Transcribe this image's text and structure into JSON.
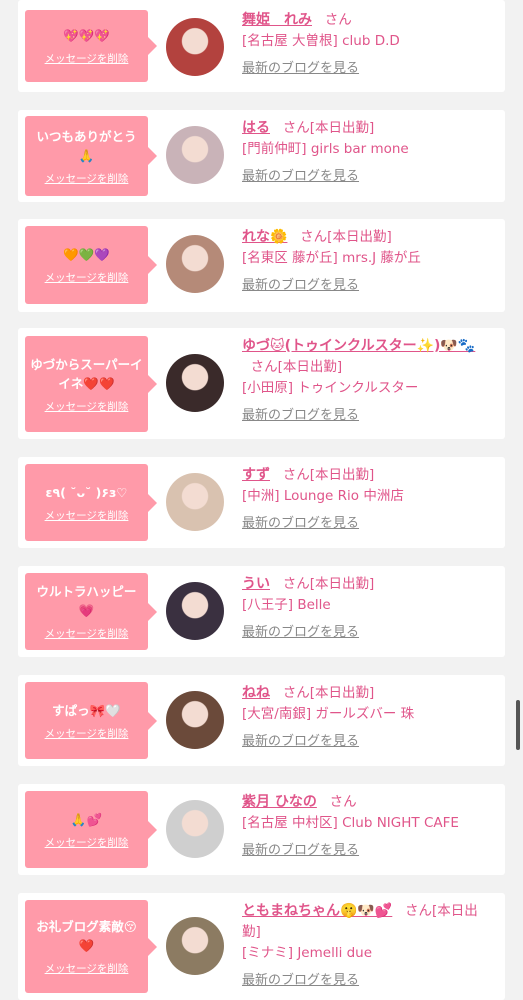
{
  "delete_label": "メッセージを削除",
  "san_label": "さん",
  "blog_label": "最新のブログを見る",
  "cards": [
    {
      "message": "💖💖💖",
      "name": "舞姫　れみ",
      "status": "",
      "shop": "[名古屋 大曽根] club D.D",
      "avatar_bg": "#b3423e"
    },
    {
      "message": "いつもありがとう🙏",
      "name": "はる",
      "status": "[本日出勤]",
      "shop": "[門前仲町] girls bar mone",
      "avatar_bg": "#c9b3b8"
    },
    {
      "message": "🧡💚💜",
      "name": "れな🌼",
      "status": "[本日出勤]",
      "shop": "[名東区 藤が丘] mrs.J 藤が丘",
      "avatar_bg": "#b58a78"
    },
    {
      "message": "ゆづからスーパーイイネ❤️❤️",
      "name": "ゆづ🐱(トゥインクルスター✨)🐶🐾",
      "status": "[本日出勤]",
      "shop": "[小田原] トゥインクルスター",
      "avatar_bg": "#3a2a2a"
    },
    {
      "message": "ε٩( ˘ᴗ˘ )۶з♡",
      "name": "すず",
      "status": "[本日出勤]",
      "shop": "[中洲] Lounge Rio 中洲店",
      "avatar_bg": "#d9c2b0"
    },
    {
      "message": "ウルトラハッピー💗",
      "name": "うい",
      "status": "[本日出勤]",
      "shop": "[八王子] Belle",
      "avatar_bg": "#3a3040"
    },
    {
      "message": "すぱっ🎀🤍",
      "name": "ねね",
      "status": "[本日出勤]",
      "shop": "[大宮/南銀] ガールズバー 珠",
      "avatar_bg": "#6b4a3a"
    },
    {
      "message": "🙏💕",
      "name": "紫月 ひなの",
      "status": "",
      "shop": "[名古屋 中村区] Club NIGHT CAFE",
      "avatar_bg": "#cfcfcf"
    },
    {
      "message": "お礼ブログ素敵😚❤️",
      "name": "ともまねちゃん🤫🐶💕",
      "status": "[本日出勤]",
      "shop": "[ミナミ] Jemelli due",
      "avatar_bg": "#8c7b62"
    }
  ]
}
